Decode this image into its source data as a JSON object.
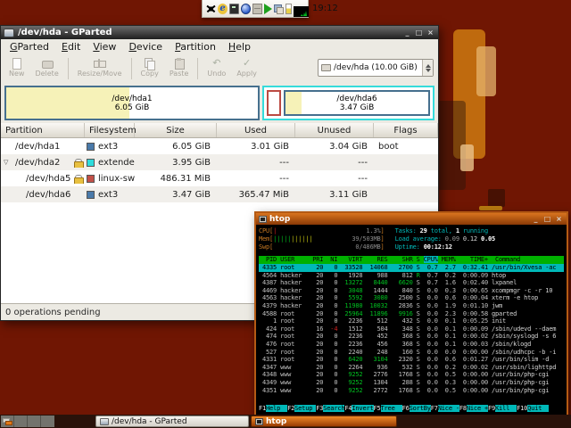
{
  "theme": {
    "desktop_bg": "#701603",
    "used_yellow": "#f6f2b8",
    "selection_cyan": "#00b8b8",
    "header_green": "#00b000",
    "htop_titlebar_top": "#d9741f",
    "htop_titlebar_bottom": "#8a3a06",
    "task_active_top": "#ef8a28",
    "task_active_bottom": "#993c02",
    "ext3_swatch": "#4a7aaa",
    "extended_swatch": "#2edcdc",
    "swap_swatch": "#c25048"
  },
  "panel": {
    "clock": "19:12",
    "icons": [
      "spider-icon",
      "browser-e-icon",
      "terminal-icon",
      "globe-icon",
      "package-icon",
      "play-icon",
      "installer-icon",
      "battery-icon",
      "cpu-graph-icon"
    ]
  },
  "gparted": {
    "title": "/dev/hda - GParted",
    "window_buttons": [
      "_",
      "□",
      "×"
    ],
    "menus": [
      "GParted",
      "Edit",
      "View",
      "Device",
      "Partition",
      "Help"
    ],
    "toolbar": [
      {
        "label": "New",
        "icon": "new"
      },
      {
        "label": "Delete",
        "icon": "del"
      },
      {
        "label": "Resize/Move",
        "icon": "res"
      },
      {
        "label": "Copy",
        "icon": "copy"
      },
      {
        "label": "Paste",
        "icon": "paste"
      },
      {
        "label": "Undo",
        "icon": "undo",
        "glyph": "↶"
      },
      {
        "label": "Apply",
        "icon": "apply",
        "glyph": "✓"
      }
    ],
    "toolbar_separators_after": [
      1,
      2,
      4
    ],
    "device_combo": "/dev/hda  (10.00 GiB)",
    "visual": {
      "hda1": {
        "name": "/dev/hda1",
        "size": "6.05 GiB",
        "used_pct": 49
      },
      "hda6": {
        "name": "/dev/hda6",
        "size": "3.47 GiB",
        "used_pct": 11
      }
    },
    "table": {
      "headers": [
        "Partition",
        "Filesystem",
        "Size",
        "Used",
        "Unused",
        "Flags"
      ],
      "rows": [
        {
          "partition": "/dev/hda1",
          "fs": "ext3",
          "fs_color": "#4a7aaa",
          "size": "6.05 GiB",
          "used": "3.01 GiB",
          "unused": "3.04 GiB",
          "flags": "boot",
          "lock": false,
          "expander": false,
          "indent": 1,
          "alt": false
        },
        {
          "partition": "/dev/hda2",
          "fs": "extended",
          "fs_color": "#2edcdc",
          "size": "3.95 GiB",
          "used": "---",
          "unused": "---",
          "flags": "",
          "lock": true,
          "expander": true,
          "indent": 1,
          "alt": true
        },
        {
          "partition": "/dev/hda5",
          "fs": "linux-swap",
          "fs_color": "#c25048",
          "size": "486.31 MiB",
          "used": "---",
          "unused": "---",
          "flags": "",
          "lock": true,
          "expander": false,
          "indent": 2,
          "alt": false
        },
        {
          "partition": "/dev/hda6",
          "fs": "ext3",
          "fs_color": "#4a7aaa",
          "size": "3.47 GiB",
          "used": "365.47 MiB",
          "unused": "3.11 GiB",
          "flags": "",
          "lock": false,
          "expander": false,
          "indent": 2,
          "alt": true
        }
      ]
    },
    "status": "0 operations pending"
  },
  "htop": {
    "title": "htop",
    "window_buttons": [
      "_",
      "□",
      "×"
    ],
    "meters": [
      [
        [
          "CPU",
          "tan"
        ],
        [
          "[",
          "tan"
        ],
        [
          "|",
          "red"
        ],
        [
          "                         1.3%",
          "gray"
        ],
        [
          "]",
          "tan"
        ],
        [
          "   ",
          ""
        ],
        [
          "Tasks: ",
          "cyan"
        ],
        [
          "29",
          "wb"
        ],
        [
          " total, ",
          "cyan"
        ],
        [
          "1",
          "wb"
        ],
        [
          " running",
          "cyan"
        ]
      ],
      [
        [
          "Mem",
          "tan"
        ],
        [
          "[",
          "tan"
        ],
        [
          "|||||",
          "green"
        ],
        [
          "||||||",
          "yellow"
        ],
        [
          "           39/503MB",
          "gray"
        ],
        [
          "]",
          "tan"
        ],
        [
          "   ",
          ""
        ],
        [
          "Load average: ",
          "cyan"
        ],
        [
          "0.09 ",
          "dim"
        ],
        [
          "0.12 ",
          "white"
        ],
        [
          "0.05",
          "wb"
        ]
      ],
      [
        [
          "Swp",
          "tan"
        ],
        [
          "[",
          "tan"
        ],
        [
          "                       0/486MB",
          "gray"
        ],
        [
          "]",
          "tan"
        ],
        [
          "   ",
          ""
        ],
        [
          "Uptime: ",
          "cyan"
        ],
        [
          "00:12:12",
          "wb"
        ]
      ]
    ],
    "columns": [
      "PID",
      "USER",
      "PRI",
      "NI",
      "VIRT",
      "RES",
      "SHR",
      "S",
      "CPU%",
      "MEM%",
      "TIME+",
      "Command"
    ],
    "sort_column": "CPU%",
    "processes": [
      {
        "pid": "4335",
        "user": "root",
        "pri": "20",
        "ni": "0",
        "virt": "33528",
        "res": "14068",
        "shr": "2700",
        "s": "S",
        "cpu": "0.7",
        "mem": "2.7",
        "time": "0:32.41",
        "cmd": "/usr/bin/Xvesa -ac",
        "selected": true
      },
      {
        "pid": "4564",
        "user": "hacker",
        "pri": "20",
        "ni": "0",
        "virt": "1928",
        "res": "988",
        "shr": "812",
        "s": "R",
        "cpu": "0.7",
        "mem": "0.2",
        "time": "0:00.09",
        "cmd": "htop",
        "selected": false
      },
      {
        "pid": "4387",
        "user": "hacker",
        "pri": "20",
        "ni": "0",
        "virt": "13272",
        "res": "8440",
        "shr": "6620",
        "s": "S",
        "cpu": "0.7",
        "mem": "1.6",
        "time": "0:02.40",
        "cmd": "lxpanel",
        "selected": false
      },
      {
        "pid": "4469",
        "user": "hacker",
        "pri": "20",
        "ni": "0",
        "virt": "3048",
        "res": "1444",
        "shr": "840",
        "s": "S",
        "cpu": "0.0",
        "mem": "0.3",
        "time": "0:00.65",
        "cmd": "xcompmgr -c -r 10",
        "selected": false
      },
      {
        "pid": "4563",
        "user": "hacker",
        "pri": "20",
        "ni": "0",
        "virt": "5592",
        "res": "3080",
        "shr": "2500",
        "s": "S",
        "cpu": "0.0",
        "mem": "0.6",
        "time": "0:00.04",
        "cmd": "xterm -e htop",
        "selected": false
      },
      {
        "pid": "4379",
        "user": "hacker",
        "pri": "20",
        "ni": "0",
        "virt": "11980",
        "res": "10032",
        "shr": "2836",
        "s": "S",
        "cpu": "0.0",
        "mem": "1.9",
        "time": "0:01.10",
        "cmd": "jwm",
        "selected": false
      },
      {
        "pid": "4588",
        "user": "root",
        "pri": "20",
        "ni": "0",
        "virt": "25964",
        "res": "11896",
        "shr": "9916",
        "s": "S",
        "cpu": "0.0",
        "mem": "2.3",
        "time": "0:00.58",
        "cmd": "gparted",
        "selected": false
      },
      {
        "pid": "1",
        "user": "root",
        "pri": "20",
        "ni": "0",
        "virt": "2236",
        "res": "512",
        "shr": "432",
        "s": "S",
        "cpu": "0.0",
        "mem": "0.1",
        "time": "0:05.25",
        "cmd": "init",
        "selected": false
      },
      {
        "pid": "424",
        "user": "root",
        "pri": "16",
        "ni": "-4",
        "virt": "1512",
        "res": "504",
        "shr": "348",
        "s": "S",
        "cpu": "0.0",
        "mem": "0.1",
        "time": "0:00.09",
        "cmd": "/sbin/udevd --daem",
        "selected": false
      },
      {
        "pid": "474",
        "user": "root",
        "pri": "20",
        "ni": "0",
        "virt": "2236",
        "res": "452",
        "shr": "368",
        "s": "S",
        "cpu": "0.0",
        "mem": "0.1",
        "time": "0:00.02",
        "cmd": "/sbin/syslogd -s 6",
        "selected": false
      },
      {
        "pid": "476",
        "user": "root",
        "pri": "20",
        "ni": "0",
        "virt": "2236",
        "res": "456",
        "shr": "368",
        "s": "S",
        "cpu": "0.0",
        "mem": "0.1",
        "time": "0:00.03",
        "cmd": "/sbin/klogd",
        "selected": false
      },
      {
        "pid": "527",
        "user": "root",
        "pri": "20",
        "ni": "0",
        "virt": "2240",
        "res": "248",
        "shr": "160",
        "s": "S",
        "cpu": "0.0",
        "mem": "0.0",
        "time": "0:00.00",
        "cmd": "/sbin/udhcpc -b -i",
        "selected": false
      },
      {
        "pid": "4331",
        "user": "root",
        "pri": "20",
        "ni": "0",
        "virt": "6420",
        "res": "3104",
        "shr": "2320",
        "s": "S",
        "cpu": "0.0",
        "mem": "0.6",
        "time": "0:01.27",
        "cmd": "/usr/bin/slim -d",
        "selected": false
      },
      {
        "pid": "4347",
        "user": "www",
        "pri": "20",
        "ni": "0",
        "virt": "2264",
        "res": "936",
        "shr": "532",
        "s": "S",
        "cpu": "0.0",
        "mem": "0.2",
        "time": "0:00.02",
        "cmd": "/usr/sbin/lighttpd",
        "selected": false
      },
      {
        "pid": "4348",
        "user": "www",
        "pri": "20",
        "ni": "0",
        "virt": "9252",
        "res": "2776",
        "shr": "1768",
        "s": "S",
        "cpu": "0.0",
        "mem": "0.5",
        "time": "0:00.00",
        "cmd": "/usr/bin/php-cgi",
        "selected": false
      },
      {
        "pid": "4349",
        "user": "www",
        "pri": "20",
        "ni": "0",
        "virt": "9252",
        "res": "1304",
        "shr": "288",
        "s": "S",
        "cpu": "0.0",
        "mem": "0.3",
        "time": "0:00.00",
        "cmd": "/usr/bin/php-cgi",
        "selected": false
      },
      {
        "pid": "4351",
        "user": "www",
        "pri": "20",
        "ni": "0",
        "virt": "9252",
        "res": "2772",
        "shr": "1768",
        "s": "S",
        "cpu": "0.0",
        "mem": "0.5",
        "time": "0:00.00",
        "cmd": "/usr/bin/php-cgi",
        "selected": false
      }
    ],
    "fkeys": [
      {
        "key": "F1",
        "label": "Help"
      },
      {
        "key": "F2",
        "label": "Setup"
      },
      {
        "key": "F3",
        "label": "Search"
      },
      {
        "key": "F4",
        "label": "Invert"
      },
      {
        "key": "F5",
        "label": "Tree"
      },
      {
        "key": "F6",
        "label": "SortBy"
      },
      {
        "key": "F7",
        "label": "Nice -"
      },
      {
        "key": "F8",
        "label": "Nice +"
      },
      {
        "key": "F9",
        "label": "Kill"
      },
      {
        "key": "F10",
        "label": "Quit"
      }
    ]
  },
  "taskbar": {
    "tasks": [
      {
        "label": "/dev/hda - GParted",
        "active": false,
        "icon": "gparted"
      },
      {
        "label": "htop",
        "active": true,
        "icon": "htop"
      }
    ]
  }
}
